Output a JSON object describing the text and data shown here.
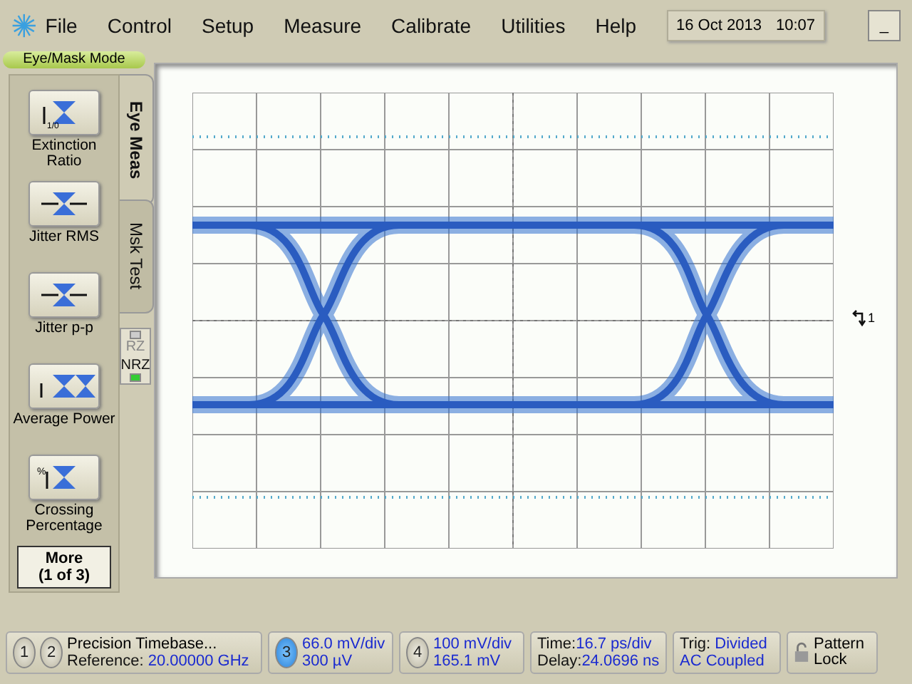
{
  "menu": {
    "items": [
      "File",
      "Control",
      "Setup",
      "Measure",
      "Calibrate",
      "Utilities",
      "Help"
    ],
    "date": "16 Oct 2013",
    "time": "10:07",
    "minimize": "_"
  },
  "mode": "Eye/Mask Mode",
  "tabs": [
    {
      "label": "Eye Meas",
      "selected": true
    },
    {
      "label": "Msk Test",
      "selected": false
    }
  ],
  "measurements": [
    {
      "kind": "extinction",
      "label": "Extinction Ratio",
      "icon_text": "1/0"
    },
    {
      "kind": "jitter_rms",
      "label": "Jitter RMS"
    },
    {
      "kind": "jitter_pp",
      "label": "Jitter p-p"
    },
    {
      "kind": "average_power",
      "label": "Average Power"
    },
    {
      "kind": "crossing",
      "label": "Crossing Percentage",
      "icon_text": "%"
    }
  ],
  "more": {
    "line1": "More",
    "line2": "(1 of 3)"
  },
  "pattern_type": [
    {
      "label": "RZ",
      "selected": false
    },
    {
      "label": "NRZ",
      "selected": true
    }
  ],
  "display": {
    "marker": "1"
  },
  "status_bar": {
    "timebase": {
      "channels": [
        {
          "label": "1",
          "selected": false
        },
        {
          "label": "2",
          "selected": false
        }
      ],
      "title": "Precision Timebase...",
      "reference_label": "Reference:",
      "reference_value": "20.00000 GHz"
    },
    "channels": [
      {
        "label": "3",
        "selected": true,
        "scale": "66.0 mV/div",
        "offset": "300 µV"
      },
      {
        "label": "4",
        "selected": false,
        "scale": "100 mV/div",
        "offset": "165.1 mV"
      }
    ],
    "time": {
      "time_label": "Time:",
      "time_value": "16.7 ps/div",
      "delay_label": "Delay:",
      "delay_value": "24.0696 ns"
    },
    "trigger": {
      "label": "Trig:",
      "source": "Divided",
      "coupling": "AC Coupled"
    },
    "pattern_lock": "Pattern Lock"
  }
}
